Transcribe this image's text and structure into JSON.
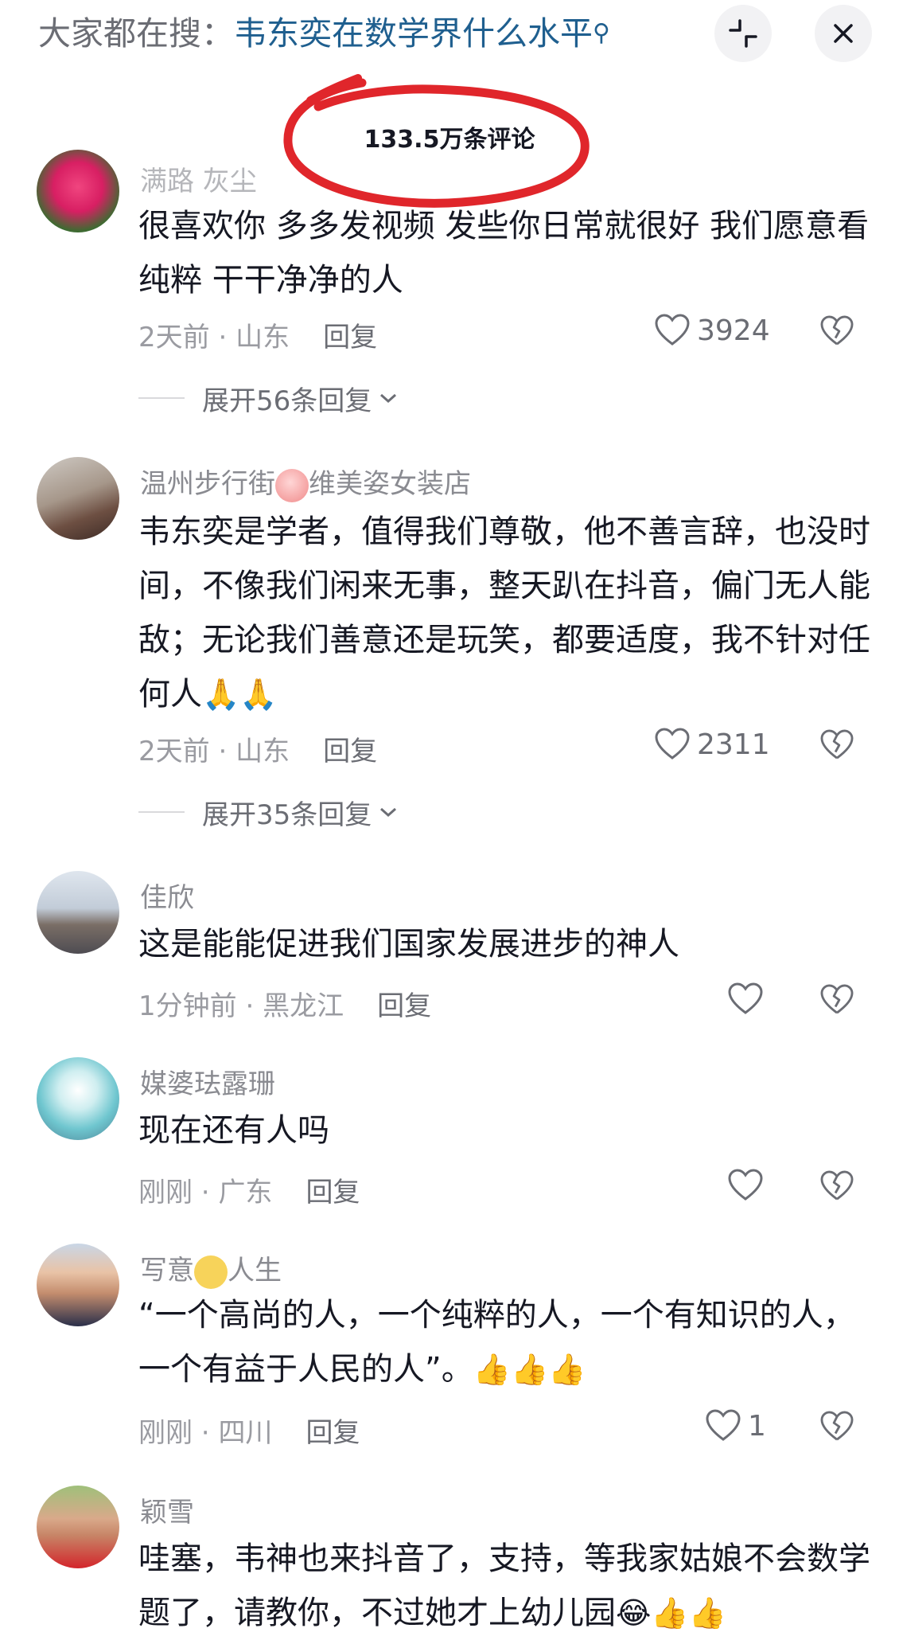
{
  "search": {
    "prefix": "大家都在搜：",
    "query": "韦东奕在数学界什么水平",
    "search_glyph": "search-icon"
  },
  "header": {
    "comment_count": "133.5万条评论",
    "collapse_icon": "collapse-icon",
    "close_icon": "close-icon",
    "annotation_color": "#e0262b"
  },
  "comments": [
    {
      "username": "满路 灰尘",
      "text": "很喜欢你 多多发视频 发些你日常就很好 我们愿意看 纯粹 干干净净的人",
      "time": "2天前",
      "location": "山东",
      "reply_label": "回复",
      "likes": "3924",
      "expand": "展开56条回复"
    },
    {
      "username_a": "温州步行街",
      "username_b": "维美姿女装店",
      "text": "韦东奕是学者，值得我们尊敬，他不善言辞，也没时间，不像我们闲来无事，整天趴在抖音，偏门无人能敌；无论我们善意还是玩笑，都要适度，我不针对任何人",
      "emoji": "🙏🙏",
      "time": "2天前",
      "location": "山东",
      "reply_label": "回复",
      "likes": "2311",
      "expand": "展开35条回复"
    },
    {
      "username": "佳欣",
      "text": "这是能能促进我们国家发展进步的神人",
      "time": "1分钟前",
      "location": "黑龙江",
      "reply_label": "回复"
    },
    {
      "username": "媒婆珐露珊",
      "text": "现在还有人吗",
      "time": "刚刚",
      "location": "广东",
      "reply_label": "回复"
    },
    {
      "username_a": "写意",
      "username_b": "人生",
      "text": "“一个高尚的人，一个纯粹的人，一个有知识的人，一个有益于人民的人”。",
      "emoji": "👍👍👍",
      "time": "刚刚",
      "location": "四川",
      "reply_label": "回复",
      "likes": "1"
    },
    {
      "username": "颖雪",
      "text": "哇塞，韦神也来抖音了，支持，等我家姑娘不会数学题了，请教你，不过她才上幼儿园",
      "emoji": "😂👍👍"
    }
  ]
}
